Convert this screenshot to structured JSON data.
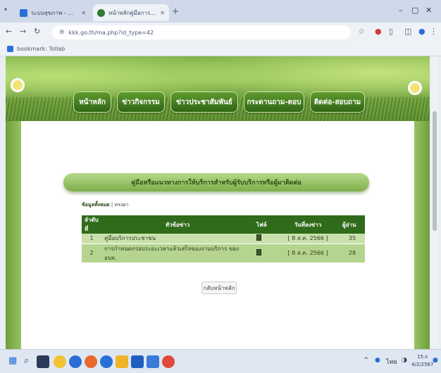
{
  "browser": {
    "tabs": [
      {
        "title": "ระบบสุขภาพ - Google ...",
        "active": false
      },
      {
        "title": "หน้าหลักคู่มือการให้บริการ ...",
        "active": true
      }
    ],
    "url": "kkk.go.th/ma.php?id_type=42",
    "bookmark": "bookmark: Tollab"
  },
  "site": {
    "menu": [
      "หน้าหลัก",
      "ข่าวกิจกรรม",
      "ข่าวประชาสัมพันธ์",
      "กระดานถาม-ตอบ",
      "ติดต่อ-สอบถาม"
    ]
  },
  "main": {
    "banner": "คู่มือหรือแนวทางการให้บริการสำหรับผู้รับบริการหรือผู้มาติดต่อ",
    "breadcrumb_bold": "ข้อมูลทั้งหมด",
    "breadcrumb_rest": " | ทรงยา",
    "table": {
      "headers": [
        "ลำดับที่",
        "หัวข้อข่าว",
        "ไฟล์",
        "วันที่ลงข่าว",
        "ผู้อ่าน"
      ],
      "rows": [
        {
          "no": "1",
          "title": "คู่มือบริการประชาชน",
          "date": "[ 8 ส.ค. 2566 ]",
          "reads": "35"
        },
        {
          "no": "2",
          "title": "การกำหนดกรอบระยะเวลาแล้วเสร็จของงานบริการ ของ อบต.",
          "date": "[ 8 ส.ค. 2566 ]",
          "reads": "28"
        }
      ]
    },
    "home_button": "กลับหน้าหลัก"
  },
  "taskbar": {
    "time": "15:x",
    "date": "4/2/2567"
  },
  "colors": {
    "menu_green": "#2f6515",
    "table_header": "#2f6b1a",
    "row_light": "#c9e0ad",
    "row_dark": "#b5d48f"
  }
}
